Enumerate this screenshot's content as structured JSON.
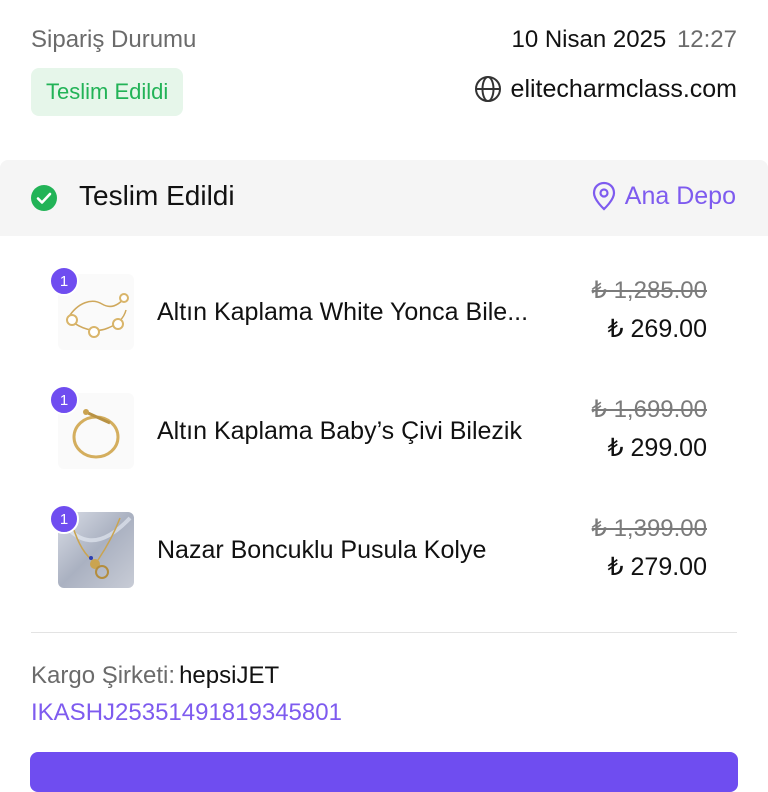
{
  "header": {
    "title": "Sipariş Durumu",
    "date": "10 Nisan 2025",
    "time": "12:27",
    "status_badge": "Teslim Edildi",
    "website": "elitecharmclass.com"
  },
  "shipment": {
    "status": "Teslim Edildi",
    "location": "Ana Depo"
  },
  "items": [
    {
      "quantity": "1",
      "name": "Altın Kaplama White Yonca Bile...",
      "old_price": "₺ 1,285.00",
      "price": "₺ 269.00"
    },
    {
      "quantity": "1",
      "name": "Altın Kaplama Baby’s Çivi Bilezik",
      "old_price": "₺ 1,699.00",
      "price": "₺ 299.00"
    },
    {
      "quantity": "1",
      "name": "Nazar Boncuklu Pusula Kolye",
      "old_price": "₺ 1,399.00",
      "price": "₺ 279.00"
    }
  ],
  "cargo": {
    "label": "Kargo Şirketi:",
    "company": "hepsiJET",
    "tracking": "IKASHJ25351491819345801"
  },
  "colors": {
    "accent": "#7e5bef",
    "success": "#22b357",
    "badge_bg": "#e6f6ea"
  },
  "icons": [
    "globe-icon",
    "check-circle-icon",
    "location-pin-icon"
  ]
}
